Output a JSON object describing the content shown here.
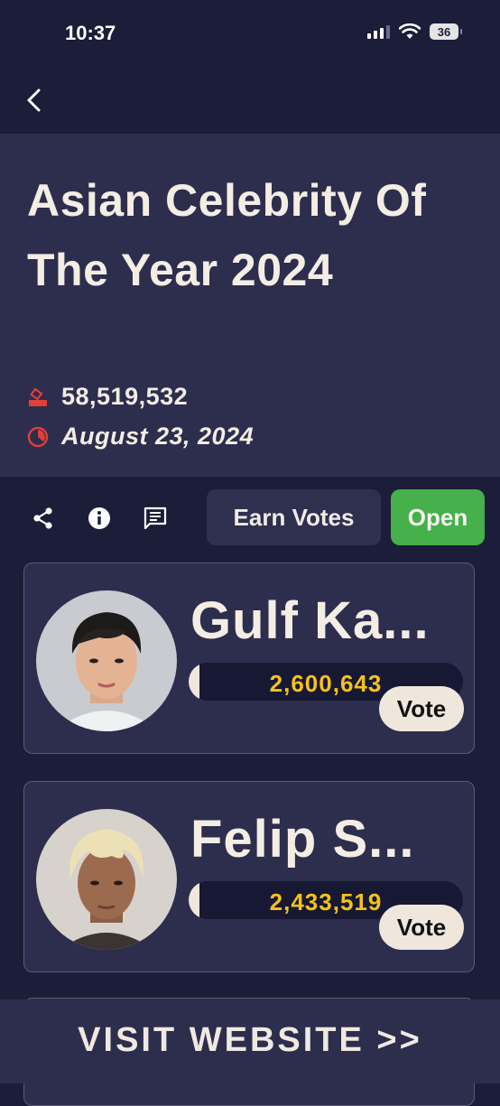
{
  "status_bar": {
    "time": "10:37",
    "battery": "36",
    "icons": [
      "cellular-signal-icon",
      "wifi-icon",
      "battery-icon"
    ]
  },
  "nav": {
    "back_icon": "chevron-left-icon"
  },
  "event": {
    "title": "Asian Celebrity Of The Year 2024",
    "total_votes": "58,519,532",
    "date": "August 23, 2024",
    "icons": [
      "ballot-box-icon",
      "clock-icon"
    ]
  },
  "actions": {
    "icons": [
      "share-icon",
      "info-icon",
      "comment-icon"
    ],
    "earn_votes_label": "Earn Votes",
    "status_label": "Open"
  },
  "candidates": [
    {
      "name": "Gulf Ka...",
      "votes": "2,600,643",
      "vote_label": "Vote",
      "progress": 0.04
    },
    {
      "name": "Felip S...",
      "votes": "2,433,519",
      "vote_label": "Vote",
      "progress": 0.04
    }
  ],
  "footer": {
    "visit_label": "VISIT WEBSITE >>"
  },
  "colors": {
    "background": "#1b1d39",
    "panel": "#2d2d4d",
    "accent_green": "#46b04a",
    "vote_count": "#f4c21a",
    "icon_red": "#e0403a",
    "text": "#f3ede4"
  }
}
